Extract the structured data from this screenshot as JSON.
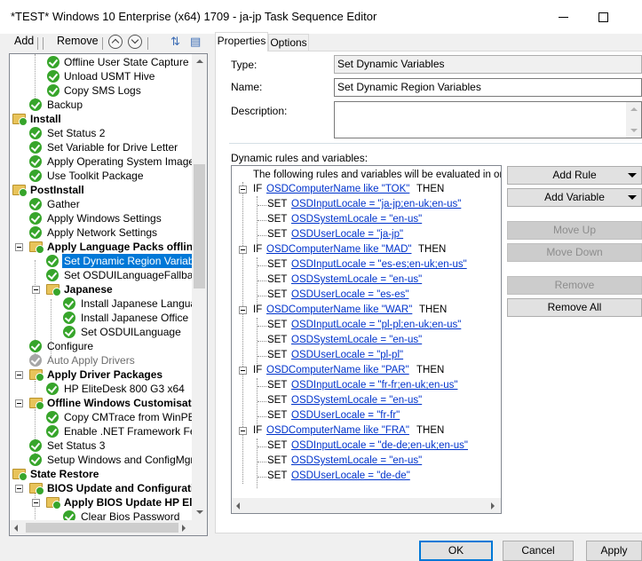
{
  "window": {
    "title": "*TEST* Windows 10 Enterprise (x64) 1709 - ja-jp Task Sequence Editor"
  },
  "toolbar": {
    "add_label": "Add",
    "remove_label": "Remove"
  },
  "tree": {
    "items": [
      {
        "label": "Offline User State Capture",
        "icon": "check-icon"
      },
      {
        "label": "Unload USMT Hive",
        "icon": "check-icon"
      },
      {
        "label": "Copy SMS Logs",
        "icon": "check-icon"
      },
      {
        "label": "Backup",
        "icon": "check-icon"
      },
      {
        "label": "Install",
        "icon": "folder-icon"
      },
      {
        "label": "Set Status 2",
        "icon": "check-icon"
      },
      {
        "label": "Set Variable for Drive Letter",
        "icon": "check-icon"
      },
      {
        "label": "Apply Operating System Image",
        "icon": "check-icon"
      },
      {
        "label": "Use Toolkit Package",
        "icon": "check-icon"
      },
      {
        "label": "PostInstall",
        "icon": "folder-icon"
      },
      {
        "label": "Gather",
        "icon": "check-icon"
      },
      {
        "label": "Apply Windows Settings",
        "icon": "check-icon"
      },
      {
        "label": "Apply Network Settings",
        "icon": "check-icon"
      },
      {
        "label": "Apply Language Packs offline",
        "icon": "folder-icon"
      },
      {
        "label": "Set Dynamic Region Variables",
        "icon": "check-icon"
      },
      {
        "label": "Set OSDUILanguageFallback",
        "icon": "check-icon"
      },
      {
        "label": "Japanese",
        "icon": "folder-icon"
      },
      {
        "label": "Install Japanese Language",
        "icon": "check-icon"
      },
      {
        "label": "Install Japanese Office Pro",
        "icon": "check-icon"
      },
      {
        "label": "Set OSDUILanguage",
        "icon": "check-icon"
      },
      {
        "label": "Configure",
        "icon": "check-icon"
      },
      {
        "label": "Auto Apply Drivers",
        "icon": "check-icon-disabled"
      },
      {
        "label": "Apply Driver Packages",
        "icon": "folder-icon"
      },
      {
        "label": "HP EliteDesk 800 G3 x64",
        "icon": "check-icon"
      },
      {
        "label": "Offline Windows Customisation",
        "icon": "folder-icon"
      },
      {
        "label": "Copy CMTrace from WinPE to",
        "icon": "check-icon"
      },
      {
        "label": "Enable .NET Framework Featu",
        "icon": "check-icon"
      },
      {
        "label": "Set Status 3",
        "icon": "check-icon"
      },
      {
        "label": "Setup Windows and ConfigMgr",
        "icon": "check-icon"
      },
      {
        "label": "State Restore",
        "icon": "folder-icon"
      },
      {
        "label": "BIOS Update and Configurati",
        "icon": "folder-icon"
      },
      {
        "label": "Apply BIOS Update HP El",
        "icon": "folder-icon"
      },
      {
        "label": "Clear Bios Password",
        "icon": "check-icon"
      }
    ]
  },
  "tabs": [
    {
      "label": "Properties"
    },
    {
      "label": "Options"
    }
  ],
  "properties": {
    "type_label": "Type:",
    "type_value": "Set Dynamic Variables",
    "name_label": "Name:",
    "name_value": "Set Dynamic Region Variables",
    "description_label": "Description:",
    "description_value": "",
    "rules_group_label": "Dynamic rules and variables:",
    "rules_intro": "The following rules and variables will be evaluated in order:"
  },
  "rules": [
    {
      "if": "IF",
      "condition": "OSDComputerName like \"TOK\"",
      "then": "THEN",
      "sets": [
        {
          "kw": "SET",
          "text": "OSDInputLocale = \"ja-jp;en-uk;en-us\""
        },
        {
          "kw": "SET",
          "text": "OSDSystemLocale = \"en-us\""
        },
        {
          "kw": "SET",
          "text": "OSDUserLocale = \"ja-jp\""
        }
      ]
    },
    {
      "if": "IF",
      "condition": "OSDComputerName like \"MAD\"",
      "then": "THEN",
      "sets": [
        {
          "kw": "SET",
          "text": "OSDInputLocale = \"es-es;en-uk;en-us\""
        },
        {
          "kw": "SET",
          "text": "OSDSystemLocale = \"en-us\""
        },
        {
          "kw": "SET",
          "text": "OSDUserLocale = \"es-es\""
        }
      ]
    },
    {
      "if": "IF",
      "condition": "OSDComputerName like \"WAR\"",
      "then": "THEN",
      "sets": [
        {
          "kw": "SET",
          "text": "OSDInputLocale = \"pl-pl;en-uk;en-us\""
        },
        {
          "kw": "SET",
          "text": "OSDSystemLocale = \"en-us\""
        },
        {
          "kw": "SET",
          "text": "OSDUserLocale = \"pl-pl\""
        }
      ]
    },
    {
      "if": "IF",
      "condition": "OSDComputerName like \"PAR\"",
      "then": "THEN",
      "sets": [
        {
          "kw": "SET",
          "text": "OSDInputLocale = \"fr-fr;en-uk;en-us\""
        },
        {
          "kw": "SET",
          "text": "OSDSystemLocale = \"en-us\""
        },
        {
          "kw": "SET",
          "text": "OSDUserLocale = \"fr-fr\""
        }
      ]
    },
    {
      "if": "IF",
      "condition": "OSDComputerName like \"FRA\"",
      "then": "THEN",
      "sets": [
        {
          "kw": "SET",
          "text": "OSDInputLocale = \"de-de;en-uk;en-us\""
        },
        {
          "kw": "SET",
          "text": "OSDSystemLocale = \"en-us\""
        },
        {
          "kw": "SET",
          "text": "OSDUserLocale = \"de-de\""
        }
      ]
    }
  ],
  "side_buttons": {
    "add_rule": "Add Rule",
    "add_variable": "Add Variable",
    "move_up": "Move Up",
    "move_down": "Move Down",
    "remove": "Remove",
    "remove_all": "Remove All"
  },
  "bottom_buttons": {
    "ok": "OK",
    "cancel": "Cancel",
    "apply": "Apply"
  },
  "colors": {
    "selection": "#0078d7",
    "link": "#0033cc",
    "check_green": "#37a52b"
  }
}
